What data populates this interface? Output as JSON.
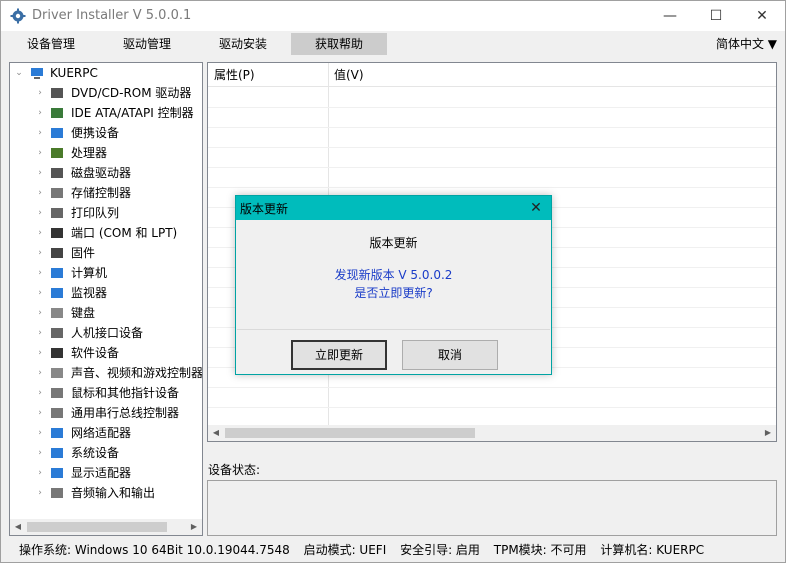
{
  "window": {
    "title": "Driver Installer V 5.0.0.1",
    "minimize": "—",
    "maximize": "☐",
    "close": "✕"
  },
  "menu": {
    "items": [
      "设备管理",
      "驱动管理",
      "驱动安装",
      "获取帮助"
    ],
    "active_index": 3,
    "language": "简体中文 ▼"
  },
  "tree": {
    "root": "KUERPC",
    "items": [
      {
        "label": "DVD/CD-ROM 驱动器",
        "icon": "dvd-drive-icon"
      },
      {
        "label": "IDE ATA/ATAPI 控制器",
        "icon": "ide-controller-icon"
      },
      {
        "label": "便携设备",
        "icon": "portable-device-icon"
      },
      {
        "label": "处理器",
        "icon": "processor-icon"
      },
      {
        "label": "磁盘驱动器",
        "icon": "disk-drive-icon"
      },
      {
        "label": "存储控制器",
        "icon": "storage-controller-icon"
      },
      {
        "label": "打印队列",
        "icon": "printer-icon"
      },
      {
        "label": "端口 (COM 和 LPT)",
        "icon": "port-icon"
      },
      {
        "label": "固件",
        "icon": "firmware-icon"
      },
      {
        "label": "计算机",
        "icon": "computer-icon"
      },
      {
        "label": "监视器",
        "icon": "monitor-icon"
      },
      {
        "label": "键盘",
        "icon": "keyboard-icon"
      },
      {
        "label": "人机接口设备",
        "icon": "hid-icon"
      },
      {
        "label": "软件设备",
        "icon": "software-device-icon"
      },
      {
        "label": "声音、视频和游戏控制器",
        "icon": "sound-icon"
      },
      {
        "label": "鼠标和其他指针设备",
        "icon": "mouse-icon"
      },
      {
        "label": "通用串行总线控制器",
        "icon": "usb-icon"
      },
      {
        "label": "网络适配器",
        "icon": "network-adapter-icon"
      },
      {
        "label": "系统设备",
        "icon": "system-device-icon"
      },
      {
        "label": "显示适配器",
        "icon": "display-adapter-icon"
      },
      {
        "label": "音频输入和输出",
        "icon": "audio-io-icon"
      }
    ]
  },
  "properties": {
    "col_property": "属性(P)",
    "col_value": "值(V)"
  },
  "device_status": {
    "label": "设备状态:"
  },
  "statusbar": {
    "os": "操作系统: Windows 10  64Bit  10.0.19044.7548",
    "boot": "启动模式: UEFI",
    "secure_boot": "安全引导: 启用",
    "tpm": "TPM模块: 不可用",
    "computer_name": "计算机名: KUERPC"
  },
  "dialog": {
    "title": "版本更新",
    "close": "✕",
    "heading": "版本更新",
    "message_line1": "发现新版本 V 5.0.0.2",
    "message_line2": "是否立即更新?",
    "update_button": "立即更新",
    "cancel_button": "取消"
  },
  "colors": {
    "dialog_title_bg": "#00bcbc",
    "link_text": "#1a3cc8",
    "menu_active_bg": "#cccccc"
  }
}
